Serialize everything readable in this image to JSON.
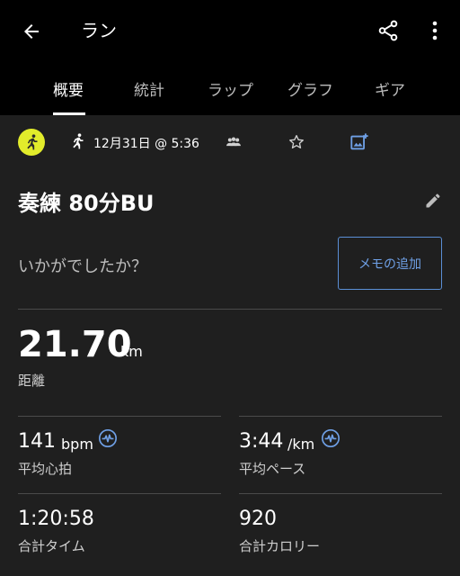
{
  "header": {
    "title": "ラン",
    "back_icon": "arrow-left-icon",
    "share_icon": "share-icon",
    "more_icon": "more-vert-icon"
  },
  "tabs": [
    {
      "label": "概要",
      "active": true
    },
    {
      "label": "統計",
      "active": false
    },
    {
      "label": "ラップ",
      "active": false
    },
    {
      "label": "グラフ",
      "active": false
    },
    {
      "label": "ギア",
      "active": false
    }
  ],
  "info_row": {
    "date_time": "12月31日 @ 5:36"
  },
  "activity": {
    "name": "奏練 80分BU"
  },
  "feel": {
    "prompt": "いかがでしたか？",
    "memo_button": "メモの追加"
  },
  "distance": {
    "value": "21.70",
    "unit": "km",
    "label": "距離"
  },
  "stats": [
    {
      "value": "141",
      "unit": "bpm",
      "label": "平均心拍",
      "has_info_icon": true
    },
    {
      "value": "3:44",
      "unit": "/km",
      "label": "平均ペース",
      "has_info_icon": true
    },
    {
      "value": "1:20:58",
      "unit": "",
      "label": "合計タイム",
      "has_info_icon": false
    },
    {
      "value": "920",
      "unit": "",
      "label": "合計カロリー",
      "has_info_icon": false
    }
  ],
  "colors": {
    "background": "#1f1f1f",
    "topbar": "#000000",
    "accent": "#6fa0e6",
    "avatar": "#e2ec2b"
  }
}
